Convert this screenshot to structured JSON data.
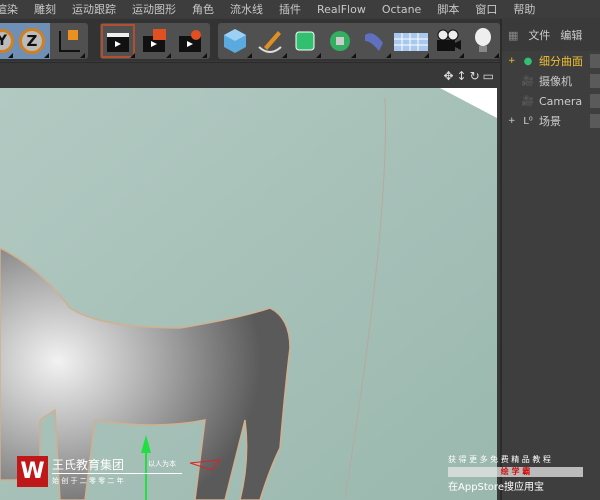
{
  "menu": [
    "渲染",
    "雕刻",
    "运动跟踪",
    "运动图形",
    "角色",
    "流水线",
    "插件",
    "RealFlow",
    "Octane",
    "脚本",
    "窗口",
    "帮助"
  ],
  "toolbar": {
    "axis_y": "Y",
    "axis_z": "Z"
  },
  "panel": {
    "menu": [
      "文件",
      "编辑"
    ],
    "objects": [
      {
        "name": "细分曲面",
        "icon": "subdivision-icon",
        "color": "#f0c030",
        "expand": "+"
      },
      {
        "name": "摄像机",
        "icon": "camera-icon",
        "color": "#c8c8c8",
        "expand": ""
      },
      {
        "name": "Camera",
        "icon": "camera-icon",
        "color": "#c8c8c8",
        "expand": ""
      },
      {
        "name": "场景",
        "icon": "null-icon",
        "color": "#c8c8c8",
        "expand": "+"
      }
    ]
  },
  "watermark": {
    "brand": "王氏教育集团",
    "slogan": "以人为本",
    "since": "始 创 于 二 零 零 二 年",
    "promo": "获 得 更 多 免 费 精 品 教 程",
    "app": "绘 学 霸",
    "store": "在AppStore搜应用宝"
  },
  "colors": {
    "viewport": "#a5c0b8",
    "highlight": "#f0c030",
    "select": "#6f8fb4"
  }
}
